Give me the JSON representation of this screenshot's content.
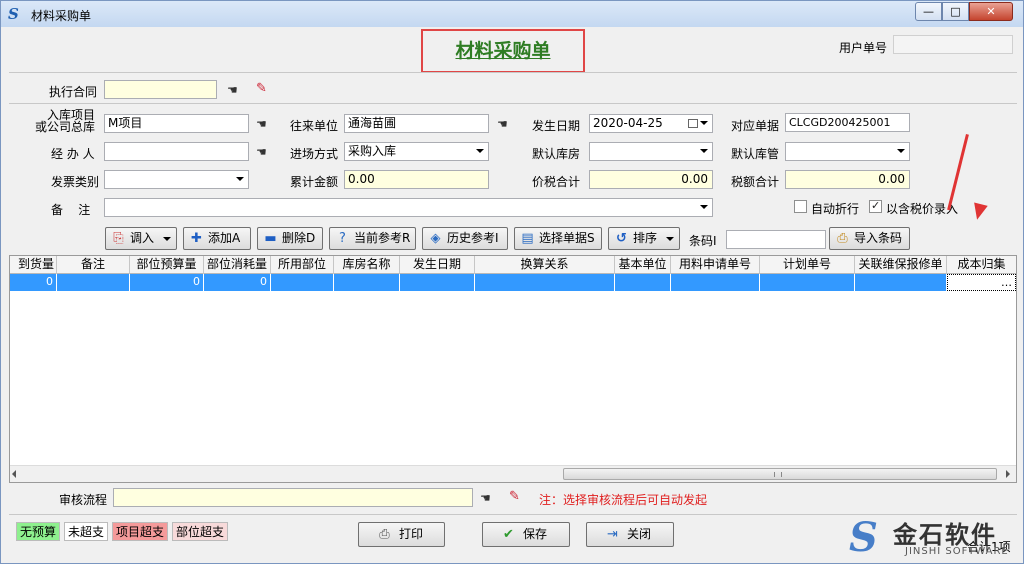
{
  "window": {
    "title": "材料采购单",
    "min": "—",
    "max": "□",
    "close": "✕"
  },
  "header": {
    "title": "材料采购单",
    "user_no_label": "用户单号",
    "user_no_value": ""
  },
  "contract": {
    "label": "执行合同",
    "value": ""
  },
  "fields": {
    "project_label": "入库项目\n或公司总库",
    "project_value": "M项目",
    "partner_label": "往来单位",
    "partner_value": "通海苗圃",
    "date_label": "发生日期",
    "date_value": "2020-04-25",
    "ref_label": "对应单据",
    "ref_value": "CLCGD200425001",
    "handler_label": "经 办 人",
    "handler_value": "",
    "method_label": "进场方式",
    "method_value": "采购入库",
    "warehouse_label": "默认库房",
    "warehouse_value": "",
    "keeper_label": "默认库管",
    "keeper_value": "",
    "invoice_label": "发票类别",
    "invoice_value": "",
    "amount_label": "累计金额",
    "amount_value": "0.00",
    "tax_total_label": "价税合计",
    "tax_total_value": "0.00",
    "tax_label": "税额合计",
    "tax_value": "0.00",
    "remark_label": "备    注",
    "remark_value": ""
  },
  "options": {
    "auto_discount": "自动折行",
    "tax_included": "以含税价录入"
  },
  "toolbar": {
    "import": "调入",
    "add": "添加A",
    "delete": "删除D",
    "current_ref": "当前参考R",
    "history_ref": "历史参考I",
    "select_doc": "选择单据S",
    "sort": "排序",
    "barcode_label": "条码I",
    "barcode_value": "",
    "import_barcode": "导入条码"
  },
  "grid": {
    "columns": [
      "到货量",
      "备注",
      "部位预算量",
      "部位消耗量",
      "所用部位",
      "库房名称",
      "发生日期",
      "换算关系",
      "基本单位",
      "用料申请单号",
      "计划单号",
      "关联维保报修单",
      "成本归集"
    ],
    "row": [
      "0",
      "",
      "0",
      "0",
      "",
      "",
      "",
      "",
      "",
      "",
      "",
      "",
      "…"
    ]
  },
  "approval": {
    "label": "审核流程",
    "value": "",
    "note": "注：选择审核流程后可自动发起"
  },
  "legend": {
    "no_budget": "无预算",
    "not_over": "未超支",
    "project_over": "项目超支",
    "part_over": "部位超支"
  },
  "colors": {
    "no_budget": "#8ef08e",
    "not_over": "#ffffff",
    "project_over": "#f49a9a",
    "part_over": "#f8dada",
    "accent": "#3399ff",
    "title_green": "#2f7d24",
    "highlight_red": "#e04646"
  },
  "bottom": {
    "print": "打印",
    "save": "保存",
    "close": "关闭"
  },
  "brand": {
    "cn": "金石软件",
    "en": "JINSHI SOFTWARE"
  },
  "footer": {
    "total": "合计1项"
  }
}
